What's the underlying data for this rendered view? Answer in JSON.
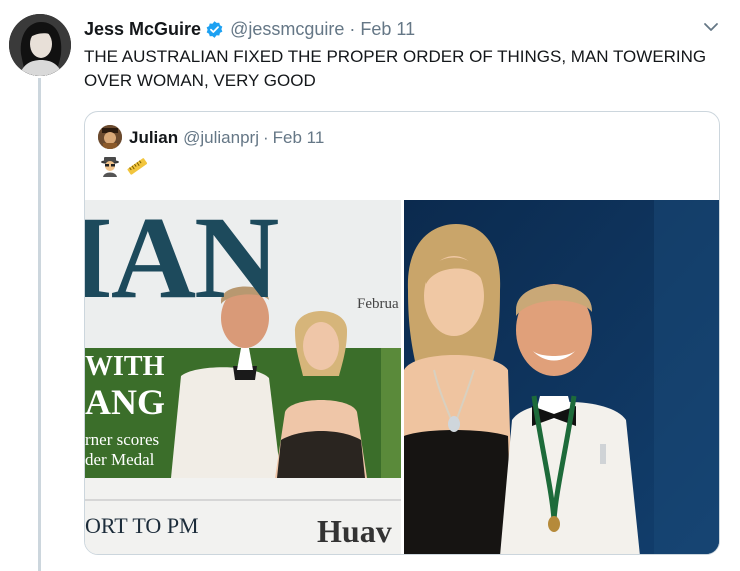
{
  "tweet": {
    "author_name": "Jess McGuire",
    "author_handle": "@jessmcguire",
    "separator": "·",
    "date": "Feb 11",
    "text": "THE AUSTRALIAN FIXED THE PROPER ORDER OF THINGS, MAN TOWERING OVER WOMAN, VERY GOOD",
    "verified_icon": "verified-badge-icon",
    "menu_icon": "chevron-down-icon"
  },
  "quote": {
    "author_name": "Julian",
    "author_handle": "@julianprj",
    "separator": "·",
    "date": "Feb 11",
    "emoji": [
      "sleuth-emoji",
      "ruler-emoji"
    ],
    "media": {
      "left_image": {
        "headline_fragment": "IAN",
        "date_fragment": "Februa",
        "banner_line1": "WITH",
        "banner_line2": "ANG",
        "caption_line1": "rner scores",
        "caption_line2": "der Medal",
        "footer_left": "ORT TO PM",
        "footer_right": "Huav"
      }
    }
  },
  "colors": {
    "text_primary": "#14171a",
    "text_secondary": "#657786",
    "border": "#ccd6dd",
    "verified_blue": "#1da1f2",
    "newspaper_banner_green": "#3b6e2a"
  }
}
